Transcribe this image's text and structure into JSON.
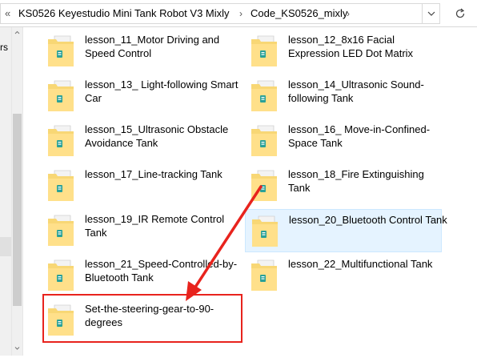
{
  "address_bar": {
    "overflow_glyph": "«",
    "crumbs": [
      "KS0526 Keyestudio Mini Tank Robot V3 Mixly",
      "Code_KS0526_mixly"
    ],
    "separator": "›",
    "dropdown_icon": "chevron-down-icon",
    "refresh_icon": "refresh-icon"
  },
  "nav_pane": {
    "visible_fragment": "rs"
  },
  "items": [
    {
      "label": "lesson_11_Motor Driving and Speed Control",
      "selected": false
    },
    {
      "label": "lesson_12_8x16 Facial Expression LED Dot Matrix",
      "selected": false
    },
    {
      "label": "lesson_13_ Light-following Smart Car",
      "selected": false
    },
    {
      "label": "lesson_14_Ultrasonic Sound-following Tank",
      "selected": false
    },
    {
      "label": "lesson_15_Ultrasonic Obstacle Avoidance Tank",
      "selected": false
    },
    {
      "label": "lesson_16_ Move-in-Confined-Space Tank",
      "selected": false
    },
    {
      "label": "lesson_17_Line-tracking Tank",
      "selected": false
    },
    {
      "label": "lesson_18_Fire Extinguishing Tank",
      "selected": false
    },
    {
      "label": "lesson_19_IR Remote Control Tank",
      "selected": false
    },
    {
      "label": "lesson_20_Bluetooth Control Tank",
      "selected": true
    },
    {
      "label": "lesson_21_Speed-Controlled-by-Bluetooth Tank",
      "selected": false
    },
    {
      "label": "lesson_22_Multifunctional Tank",
      "selected": false
    },
    {
      "label": "Set-the-steering-gear-to-90-degrees",
      "selected": false
    }
  ],
  "annotation": {
    "color": "#e8231d"
  }
}
